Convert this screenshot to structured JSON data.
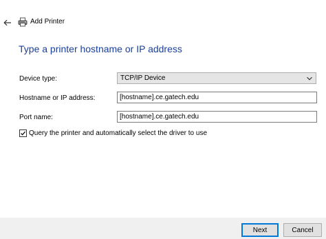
{
  "window": {
    "title": "Add Printer",
    "back_icon": "arrow-left-icon",
    "app_icon": "printer-icon"
  },
  "page": {
    "heading": "Type a printer hostname or IP address",
    "heading_color": "#1a3f9a"
  },
  "form": {
    "device_type": {
      "label": "Device type:",
      "selected": "TCP/IP Device"
    },
    "hostname": {
      "label": "Hostname or IP address:",
      "value": "[hostname].ce.gatech.edu"
    },
    "port_name": {
      "label": "Port name:",
      "value": "[hostname].ce.gatech.edu"
    },
    "query_checkbox": {
      "label": "Query the printer and automatically select the driver to use",
      "checked": true
    }
  },
  "buttons": {
    "next": "Next",
    "cancel": "Cancel"
  }
}
